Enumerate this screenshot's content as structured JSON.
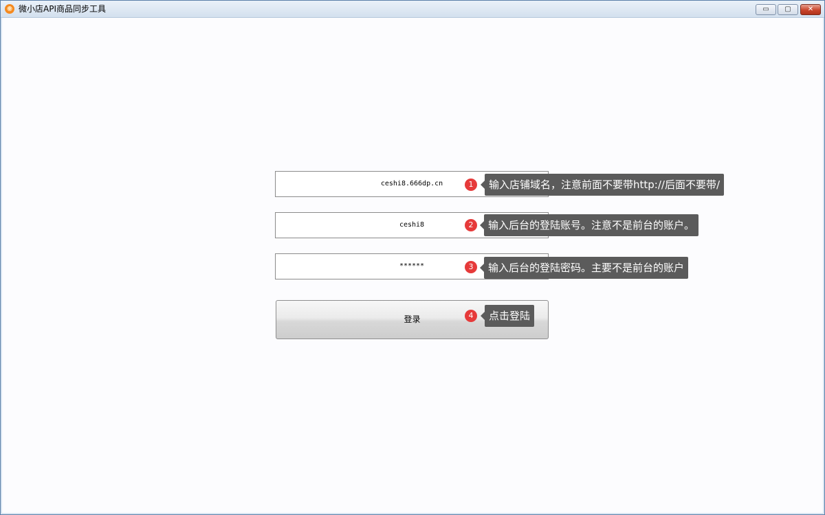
{
  "window": {
    "title": "微小店API商品同步工具",
    "icon": "app-logo-icon",
    "controls": {
      "minimize": "▭",
      "maximize": "▢",
      "close": "✕"
    }
  },
  "form": {
    "domain_value": "ceshi8.666dp.cn",
    "account_value": "ceshi8",
    "password_value": "******",
    "login_label": "登录"
  },
  "hints": [
    {
      "num": "1",
      "text": "输入店铺域名，注意前面不要带http://后面不要带/"
    },
    {
      "num": "2",
      "text": "输入后台的登陆账号。注意不是前台的账户。"
    },
    {
      "num": "3",
      "text": "输入后台的登陆密码。主要不是前台的账户"
    },
    {
      "num": "4",
      "text": "点击登陆"
    }
  ],
  "colors": {
    "badge": "#e63a3a",
    "tooltip": "#5b5b5b",
    "background": "#fcfcfe"
  }
}
